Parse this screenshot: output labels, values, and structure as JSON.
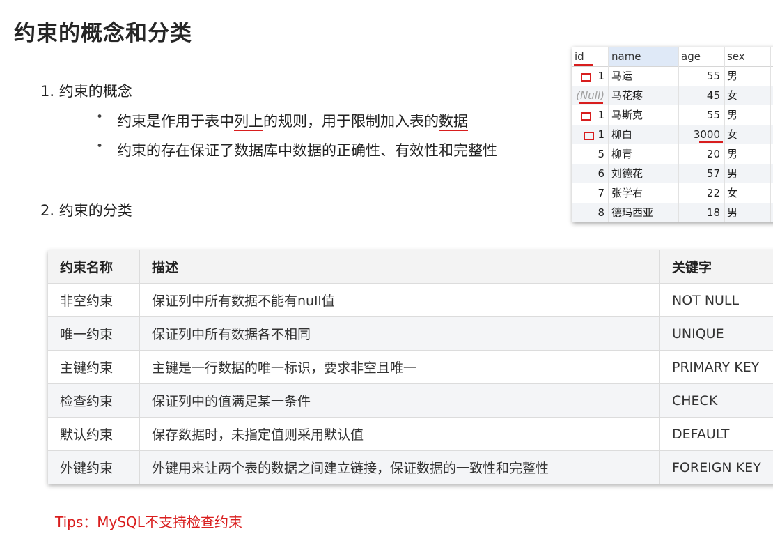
{
  "title": "约束的概念和分类",
  "section1": {
    "label": "1. 约束的概念"
  },
  "bullets": {
    "b1": {
      "pre": "约束是作用于表中",
      "u1": "列上",
      "mid": "的规则，用于限制加入表的",
      "u2": "数据"
    },
    "b2": "约束的存在保证了数据库中数据的正确性、有效性和完整性"
  },
  "section2": {
    "label": "2. 约束的分类"
  },
  "sample_grid": {
    "columns": [
      "id",
      "name",
      "age",
      "sex"
    ],
    "rows": [
      {
        "id": "1",
        "name": "马运",
        "age": "55",
        "sex": "男"
      },
      {
        "id": "(Null)",
        "name": "马花疼",
        "age": "45",
        "sex": "女"
      },
      {
        "id": "1",
        "name": "马斯克",
        "age": "55",
        "sex": "男"
      },
      {
        "id": "1",
        "name": "柳白",
        "age": "3000",
        "sex": "女"
      },
      {
        "id": "5",
        "name": "柳青",
        "age": "20",
        "sex": "男"
      },
      {
        "id": "6",
        "name": "刘德花",
        "age": "57",
        "sex": "男"
      },
      {
        "id": "7",
        "name": "张学右",
        "age": "22",
        "sex": "女"
      },
      {
        "id": "8",
        "name": "德玛西亚",
        "age": "18",
        "sex": "男"
      }
    ]
  },
  "constraints_table": {
    "headers": [
      "约束名称",
      "描述",
      "关键字"
    ],
    "rows": [
      {
        "name": "非空约束",
        "desc": "保证列中所有数据不能有null值",
        "keyword": "NOT NULL"
      },
      {
        "name": "唯一约束",
        "desc": "保证列中所有数据各不相同",
        "keyword": "UNIQUE"
      },
      {
        "name": "主键约束",
        "desc": "主键是一行数据的唯一标识，要求非空且唯一",
        "keyword": "PRIMARY KEY"
      },
      {
        "name": "检查约束",
        "desc": "保证列中的值满足某一条件",
        "keyword": "CHECK"
      },
      {
        "name": "默认约束",
        "desc": "保存数据时，未指定值则采用默认值",
        "keyword": "DEFAULT"
      },
      {
        "name": "外键约束",
        "desc": "外键用来让两个表的数据之间建立链接，保证数据的一致性和完整性",
        "keyword": "FOREIGN KEY"
      }
    ]
  },
  "tips": "Tips：MySQL不支持检查约束",
  "colors": {
    "annotation_red": "#d81e1e",
    "tips_red": "#d91e1e"
  }
}
